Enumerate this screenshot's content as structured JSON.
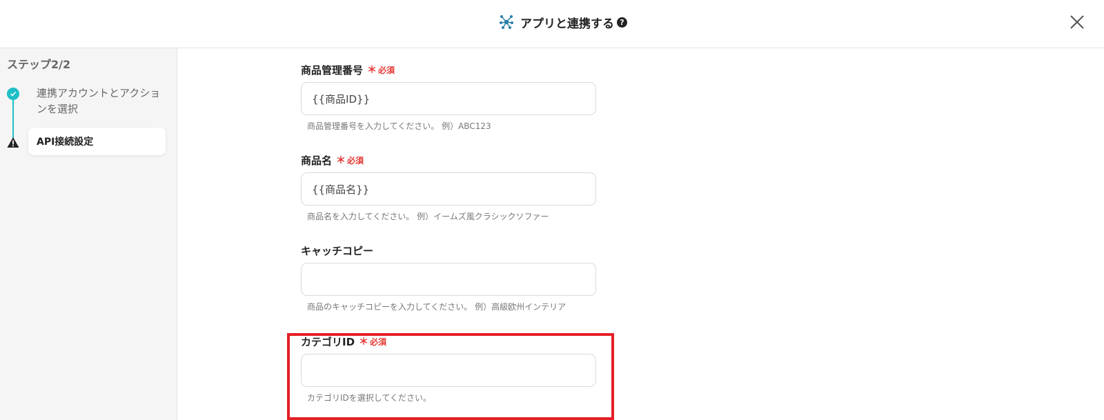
{
  "header": {
    "title": "アプリと連携する",
    "help_icon": "?"
  },
  "sidebar": {
    "step_heading": "ステップ2/2",
    "steps": [
      {
        "label": "連携アカウントとアクションを選択",
        "status": "done"
      },
      {
        "label": "API接続設定",
        "status": "warning"
      }
    ]
  },
  "form": {
    "fields": [
      {
        "label": "商品管理番号",
        "required_mark": "＊",
        "required_text": "必須",
        "value": "{{商品ID}}",
        "help": "商品管理番号を入力してください。 例）ABC123"
      },
      {
        "label": "商品名",
        "required_mark": "＊",
        "required_text": "必須",
        "value": "{{商品名}}",
        "help": "商品名を入力してください。 例）イームズ風クラシックソファー"
      },
      {
        "label": "キャッチコピー",
        "value": "",
        "help": "商品のキャッチコピーを入力してください。 例）高級欧州インテリア"
      },
      {
        "label": "カテゴリID",
        "required_mark": "＊",
        "required_text": "必須",
        "value": "",
        "help": "カテゴリIDを選択してください。"
      }
    ]
  },
  "colors": {
    "accent": "#1fbfc6",
    "required": "#e53935",
    "highlight": "#e41f26"
  },
  "icons": {
    "header": "hub-network-icon",
    "close": "close-icon",
    "step_done": "check-circle-icon",
    "step_warning": "warning-icon"
  }
}
